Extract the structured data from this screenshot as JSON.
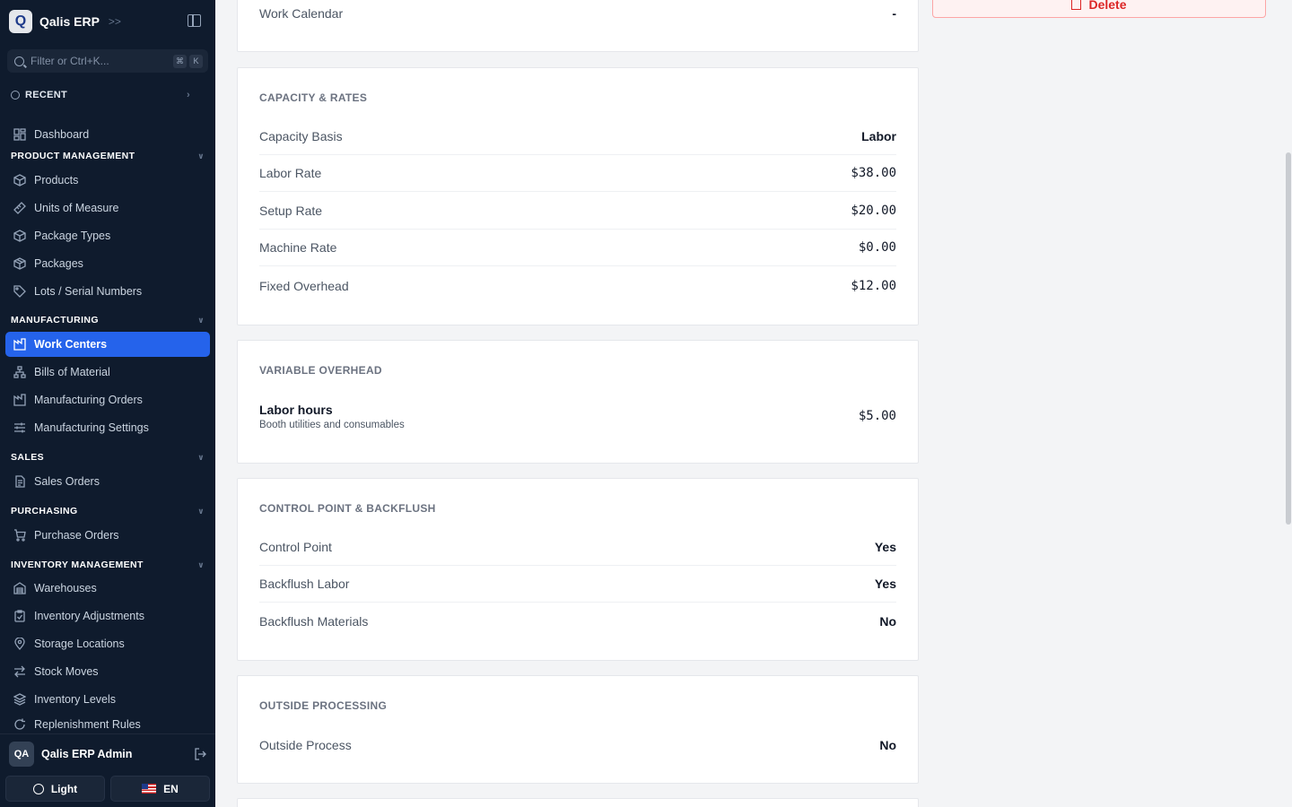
{
  "sidebar": {
    "brand": {
      "logo_letter": "Q",
      "name": "Qalis ERP"
    },
    "filter_placeholder": "Filter or Ctrl+K...",
    "shortcut_keys": [
      "⌘",
      "K"
    ],
    "recent_label": "RECENT",
    "dashboard": "Dashboard",
    "sections": {
      "product_management": "PRODUCT MANAGEMENT",
      "manufacturing": "MANUFACTURING",
      "sales": "SALES",
      "purchasing": "PURCHASING",
      "inventory_management": "INVENTORY MANAGEMENT"
    },
    "items": {
      "products": "Products",
      "units_of_measure": "Units of Measure",
      "package_types": "Package Types",
      "packages": "Packages",
      "lots_serial": "Lots / Serial Numbers",
      "work_centers": "Work Centers",
      "bills_of_material": "Bills of Material",
      "manufacturing_orders": "Manufacturing Orders",
      "manufacturing_settings": "Manufacturing Settings",
      "sales_orders": "Sales Orders",
      "purchase_orders": "Purchase Orders",
      "warehouses": "Warehouses",
      "inventory_adjustments": "Inventory Adjustments",
      "storage_locations": "Storage Locations",
      "stock_moves": "Stock Moves",
      "inventory_levels": "Inventory Levels",
      "replenishment_rules": "Replenishment Rules"
    },
    "user": {
      "initials": "QA",
      "name": "Qalis ERP Admin"
    },
    "theme_label": "Light",
    "language_label": "EN"
  },
  "main": {
    "work_calendar": {
      "label": "Work Calendar",
      "value": "-"
    },
    "capacity": {
      "title": "CAPACITY & RATES",
      "rows": [
        {
          "label": "Capacity Basis",
          "value": "Labor"
        },
        {
          "label": "Labor Rate",
          "value": "$38.00"
        },
        {
          "label": "Setup Rate",
          "value": "$20.00"
        },
        {
          "label": "Machine Rate",
          "value": "$0.00"
        },
        {
          "label": "Fixed Overhead",
          "value": "$12.00"
        }
      ]
    },
    "variable_overhead": {
      "title": "VARIABLE OVERHEAD",
      "label": "Labor hours",
      "description": "Booth utilities and consumables",
      "value": "$5.00"
    },
    "control": {
      "title": "CONTROL POINT & BACKFLUSH",
      "rows": [
        {
          "label": "Control Point",
          "value": "Yes"
        },
        {
          "label": "Backflush Labor",
          "value": "Yes"
        },
        {
          "label": "Backflush Materials",
          "value": "No"
        }
      ]
    },
    "outside": {
      "title": "OUTSIDE PROCESSING",
      "rows": [
        {
          "label": "Outside Process",
          "value": "No"
        }
      ]
    },
    "delete_label": "Delete"
  },
  "colors": {
    "sidebar_bg": "#0f1b2d",
    "active": "#2563eb",
    "danger": "#dc2626"
  }
}
